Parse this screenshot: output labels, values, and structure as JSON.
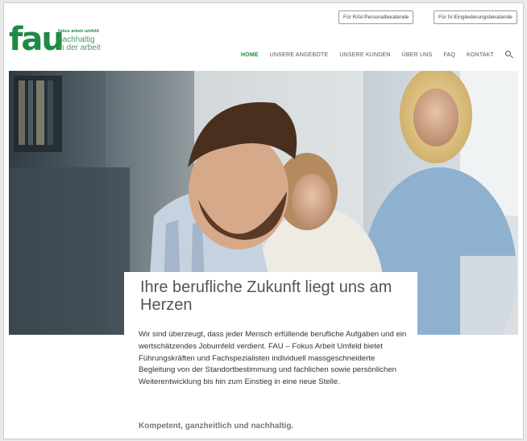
{
  "header": {
    "top_links": [
      "Für RAV-Personalberatende",
      "Für IV-Eingliederungsberatende"
    ],
    "logo": {
      "mark": "fau",
      "small": "fokus arbeit umfeld",
      "line1": "nachhaltig",
      "line2": "in der arbeit"
    }
  },
  "nav": {
    "items": [
      "HOME",
      "UNSERE ANGEBOTE",
      "UNSERE KUNDEN",
      "ÜBER UNS",
      "FAQ",
      "KONTAKT"
    ],
    "active": "HOME"
  },
  "hero": {
    "headline": "Ihre berufliche Zukunft liegt uns am Herzen",
    "body": "Wir sind überzeugt, dass jeder Mensch erfüllende berufliche Aufgaben und ein wertschätzendes Jobumfeld verdient. FAU – Fokus Arbeit Umfeld bietet Führungskräften und Fachspezialisten individuell massgeschneiderte Begleitung von der Standortbestimmung und fachlichen sowie persönlichen Weiterentwicklung bis hin zum Einstieg in eine neue Stelle.",
    "tagline": "Kompetent, ganzheitlich und nachhaltig."
  },
  "colors": {
    "brand_green": "#1f8a45",
    "text": "#333333"
  }
}
